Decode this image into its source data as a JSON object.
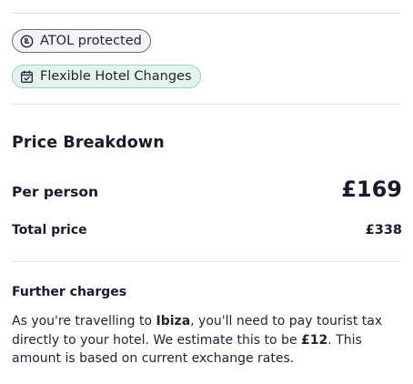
{
  "badges": {
    "atol": {
      "label": "ATOL protected",
      "icon": "atol-shield-icon"
    },
    "flexible": {
      "label": "Flexible Hotel Changes",
      "icon": "calendar-check-icon"
    }
  },
  "price_breakdown": {
    "title": "Price Breakdown",
    "per_person_label": "Per person",
    "per_person_value": "£169",
    "total_label": "Total price",
    "total_value": "£338"
  },
  "further_charges": {
    "title": "Further charges",
    "text_1": "As you're travelling to ",
    "destination": "Ibiza",
    "text_2": ", you'll need to pay tourist tax directly to your hotel. We estimate this to be ",
    "tax_amount": "£12",
    "text_3": ". This amount is based on current exchange rates."
  },
  "colors": {
    "text": "#1a1a2e",
    "divider": "#e3e3e8",
    "flexible_badge_bg": "#e3f4ed",
    "flexible_badge_border": "#99d3bd"
  }
}
